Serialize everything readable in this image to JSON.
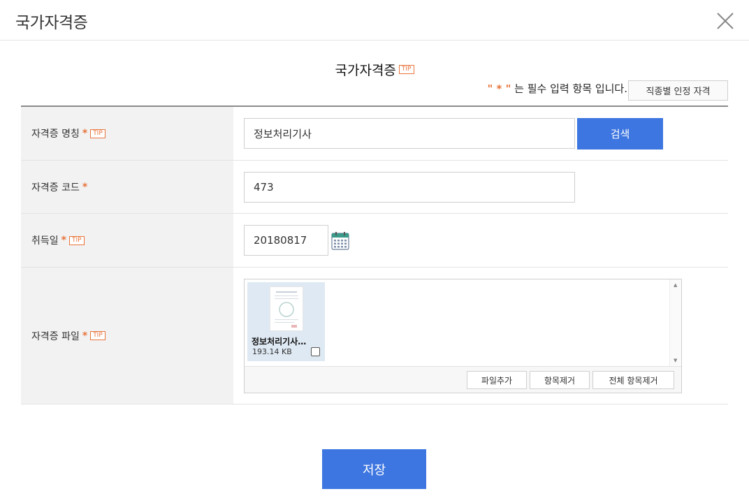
{
  "modal": {
    "title": "국가자격증"
  },
  "section": {
    "title": "국가자격증",
    "tip_label": "TIP"
  },
  "required_note": {
    "quote_open": "\" * \"",
    "text": " 는 필수 입력 항목 입니다."
  },
  "cert_button_label": "직종별 인정 자격",
  "fields": {
    "name": {
      "label": "자격증 명칭",
      "required_mark": "*",
      "tip": "TIP",
      "value": "정보처리기사",
      "search_label": "검색"
    },
    "code": {
      "label": "자격증 코드",
      "required_mark": "*",
      "value": "473"
    },
    "date": {
      "label": "취득일",
      "required_mark": "*",
      "tip": "TIP",
      "value": "20180817"
    },
    "file": {
      "label": "자격증 파일",
      "required_mark": "*",
      "tip": "TIP"
    }
  },
  "uploader": {
    "files": [
      {
        "name": "정보처리기사…",
        "size": "193.14 KB",
        "checked": false
      }
    ],
    "buttons": {
      "add": "파일추가",
      "remove": "항목제거",
      "remove_all": "전체 항목제거"
    }
  },
  "save_label": "저장",
  "icons": {
    "close": "close-icon",
    "calendar": "calendar-icon"
  },
  "colors": {
    "primary": "#3d76e0",
    "accent": "#e8743b"
  }
}
